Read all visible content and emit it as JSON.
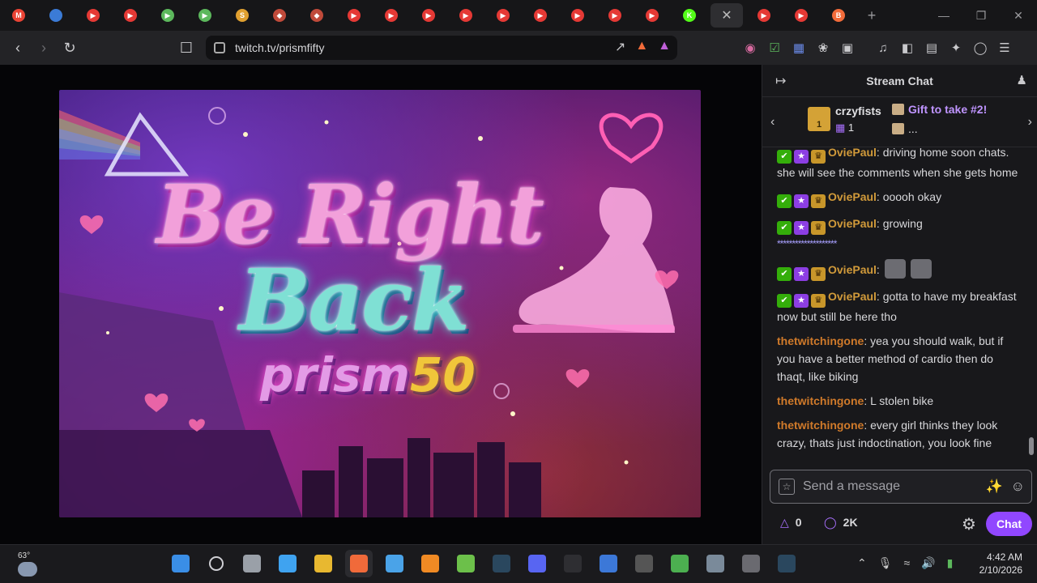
{
  "browser": {
    "tabs": [
      {
        "icon": "gmail-icon",
        "color": "#ea4335",
        "glyph": "M"
      },
      {
        "icon": "multicolor-icon",
        "color": "#3b7bd6",
        "glyph": ""
      },
      {
        "icon": "youtube-icon",
        "color": "#e53935",
        "glyph": "▶"
      },
      {
        "icon": "youtube-icon",
        "color": "#e53935",
        "glyph": "▶"
      },
      {
        "icon": "play-green-icon",
        "color": "#5cb85c",
        "glyph": "▶"
      },
      {
        "icon": "play-green-icon",
        "color": "#5cb85c",
        "glyph": "▶"
      },
      {
        "icon": "coin-icon",
        "color": "#e0a030",
        "glyph": "S"
      },
      {
        "icon": "shield-icon",
        "color": "#c04a3a",
        "glyph": "◆"
      },
      {
        "icon": "shield-icon",
        "color": "#c04a3a",
        "glyph": "◆"
      },
      {
        "icon": "youtube-icon",
        "color": "#e53935",
        "glyph": "▶"
      },
      {
        "icon": "youtube-icon",
        "color": "#e53935",
        "glyph": "▶"
      },
      {
        "icon": "youtube-icon",
        "color": "#e53935",
        "glyph": "▶"
      },
      {
        "icon": "youtube-icon",
        "color": "#e53935",
        "glyph": "▶"
      },
      {
        "icon": "youtube-icon",
        "color": "#e53935",
        "glyph": "▶"
      },
      {
        "icon": "youtube-icon",
        "color": "#e53935",
        "glyph": "▶"
      },
      {
        "icon": "youtube-icon",
        "color": "#e53935",
        "glyph": "▶"
      },
      {
        "icon": "youtube-icon",
        "color": "#e53935",
        "glyph": "▶"
      },
      {
        "icon": "youtube-icon",
        "color": "#e53935",
        "glyph": "▶"
      },
      {
        "icon": "kick-icon",
        "color": "#53fc18",
        "glyph": "K"
      }
    ],
    "url": "twitch.tv/prismfifty",
    "new_tab_glyph": "+",
    "close_glyph": "✕"
  },
  "stream": {
    "brb_line1": "Be Right",
    "brb_line2": "Back",
    "brb_line3a": "prism",
    "brb_line3b": "50"
  },
  "chat": {
    "title": "Stream Chat",
    "gift": {
      "user": "crzyfists",
      "box_count": "1",
      "count": "1",
      "message": "Gift to take #2!",
      "message2": "..."
    },
    "messages": [
      {
        "badges": true,
        "user": "OviePaul",
        "text": ": driving home soon chats. she will see the comments when she gets home"
      },
      {
        "badges": true,
        "user": "OviePaul",
        "text": ": ooooh okay"
      },
      {
        "badges": true,
        "user": "OviePaul",
        "text": ": growing",
        "stars": "********************"
      },
      {
        "badges": true,
        "user": "OviePaul",
        "text": ":",
        "emotes": 2
      },
      {
        "badges": true,
        "user": "OviePaul",
        "text": ": gotta to have my breakfast now but still be here tho"
      },
      {
        "badges": false,
        "user": "thetwitchingone",
        "text": ": yea you should walk, but if you have a better method of cardio then do thaqt, like biking"
      },
      {
        "badges": false,
        "user": "thetwitchingone",
        "text": ": L stolen bike"
      },
      {
        "badges": false,
        "user": "thetwitchingone",
        "text": ": every girl thinks they look crazy, thats just indoctination, you look fine"
      }
    ],
    "input_placeholder": "Send a message",
    "bits": "0",
    "points": "2K",
    "chat_button": "Chat"
  },
  "taskbar": {
    "temperature": "63°",
    "time": "4:42 AM",
    "date": "2/10/2026",
    "app_colors": [
      "#3a8ee6",
      "#cfcfd4",
      "#9aa0a8",
      "#3fa3f0",
      "#e8b830",
      "#f06a3a",
      "#4aa3e8",
      "#f08a24",
      "#6cc04a",
      "#2a475e",
      "#5865f2",
      "#2e2e32",
      "#3c78d8",
      "#555",
      "#4caf50",
      "#7a8a9a",
      "#6a6a70",
      "#2a475e"
    ]
  }
}
